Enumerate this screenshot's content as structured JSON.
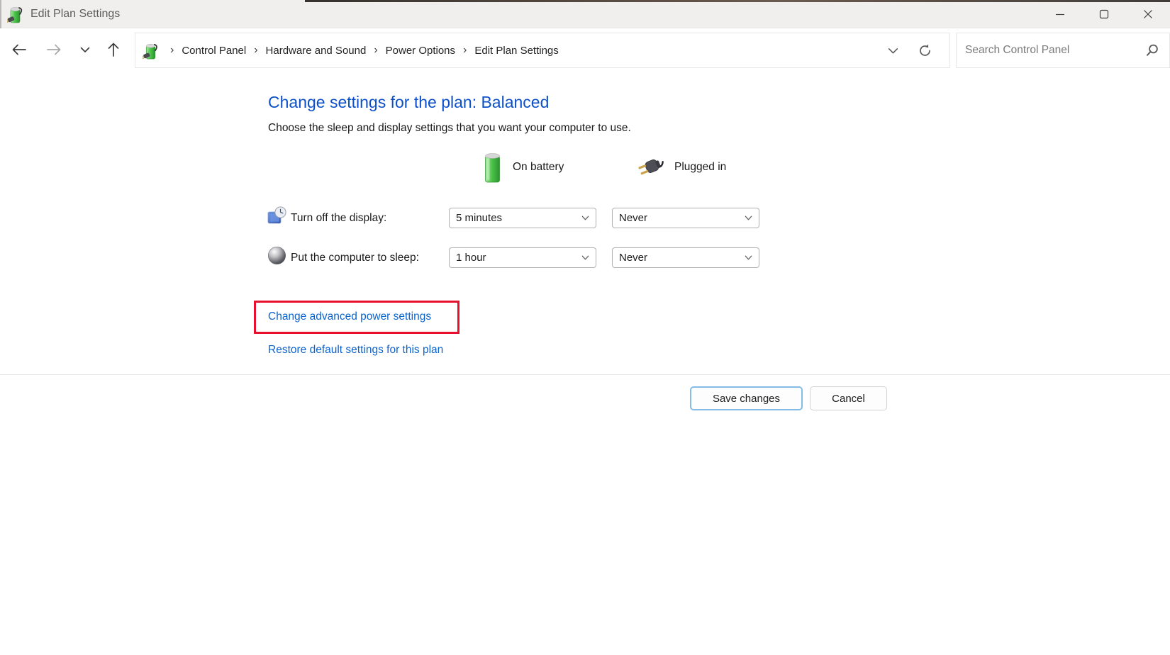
{
  "window": {
    "title": "Edit Plan Settings"
  },
  "navbar": {
    "breadcrumb": {
      "separator": "›",
      "items": [
        "Control Panel",
        "Hardware and Sound",
        "Power Options",
        "Edit Plan Settings"
      ]
    },
    "search": {
      "placeholder": "Search Control Panel"
    }
  },
  "main": {
    "heading": "Change settings for the plan: Balanced",
    "subheading": "Choose the sleep and display settings that you want your computer to use.",
    "columns": {
      "on_battery": "On battery",
      "plugged_in": "Plugged in"
    },
    "rows": [
      {
        "label": "Turn off the display:",
        "on_battery": "5 minutes",
        "plugged_in": "Never"
      },
      {
        "label": "Put the computer to sleep:",
        "on_battery": "1 hour",
        "plugged_in": "Never"
      }
    ],
    "links": {
      "advanced": "Change advanced power settings",
      "restore": "Restore default settings for this plan"
    },
    "buttons": {
      "save": "Save changes",
      "cancel": "Cancel"
    }
  },
  "colors": {
    "heading_blue": "#0b50c8",
    "link_blue": "#0c63ce",
    "highlight_red": "#e8112d",
    "save_focus_border": "#85bce6"
  }
}
